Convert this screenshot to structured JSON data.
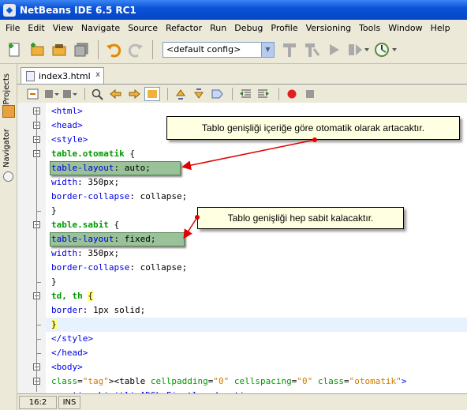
{
  "window": {
    "title": "NetBeans IDE 6.5 RC1"
  },
  "menu": [
    "File",
    "Edit",
    "View",
    "Navigate",
    "Source",
    "Refactor",
    "Run",
    "Debug",
    "Profile",
    "Versioning",
    "Tools",
    "Window",
    "Help"
  ],
  "toolbar": {
    "config_value": "<default config>"
  },
  "side_tabs": {
    "projects": "Projects",
    "navigator": "Navigator"
  },
  "editor_tab": {
    "label": "index3.html",
    "close": "x"
  },
  "code": {
    "lines": [
      {
        "t": "<html>",
        "k": "tag"
      },
      {
        "t": "<head>",
        "k": "tag"
      },
      {
        "t": "<style>",
        "k": "tag"
      },
      {
        "t": "table.otomatik {",
        "k": "selector"
      },
      {
        "t": "table-layout: auto;",
        "k": "prop"
      },
      {
        "t": "width: 350px;",
        "k": "prop"
      },
      {
        "t": "border-collapse: collapse;",
        "k": "prop"
      },
      {
        "t": "}",
        "k": "plain"
      },
      {
        "t": "table.sabit {",
        "k": "selector"
      },
      {
        "t": "table-layout: fixed;",
        "k": "prop"
      },
      {
        "t": "width: 350px;",
        "k": "prop"
      },
      {
        "t": "border-collapse: collapse;",
        "k": "prop"
      },
      {
        "t": "}",
        "k": "plain"
      },
      {
        "t": "td, th {",
        "k": "selector"
      },
      {
        "t": "border: 1px solid;",
        "k": "prop"
      },
      {
        "t": "}",
        "k": "plain"
      },
      {
        "t": "</style>",
        "k": "tag"
      },
      {
        "t": "</head>",
        "k": "tag"
      },
      {
        "t": "<body>",
        "k": "tag"
      },
      {
        "t": "<table cellpadding=\"0\" cellspacing=\"0\" class=\"otomatik\">",
        "k": "tagattr"
      },
      {
        "t": "<caption>Limitli ADSL Fiyatlar</caption>",
        "k": "tag"
      }
    ]
  },
  "annotations": {
    "callout1": "Tablo genişliği içeriğe göre otomatik olarak artacaktır.",
    "callout2": "Tablo genişliği hep sabit kalacaktır."
  },
  "status": {
    "position": "16:2",
    "mode": "INS"
  },
  "colors": {
    "title_bar": "#0a53d8",
    "callout_bg": "#ffffe1",
    "highlight_box": "#8fbc8f",
    "arrow": "#e00000"
  }
}
